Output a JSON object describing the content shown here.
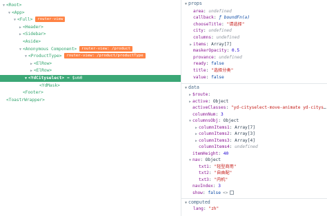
{
  "tree": [
    {
      "label": "<Root>",
      "caret": "down",
      "badge": ""
    },
    {
      "label": "<App>",
      "caret": "down",
      "badge": ""
    },
    {
      "label": "<Full>",
      "caret": "down",
      "badge": "router-view"
    },
    {
      "label": "<Header>",
      "caret": "right",
      "badge": ""
    },
    {
      "label": "<Sidebar>",
      "caret": "right",
      "badge": ""
    },
    {
      "label": "<Aside>",
      "caret": "",
      "badge": ""
    },
    {
      "label": "<Anonymous Component>",
      "caret": "down",
      "badge": "router-view: /product"
    },
    {
      "label": "<ProductType>",
      "caret": "down",
      "badge": "router-view: /product/productType"
    },
    {
      "label": "<ElRow>",
      "caret": "right",
      "badge": ""
    },
    {
      "label": "<ElRow>",
      "caret": "right",
      "badge": ""
    },
    {
      "label": "<YdCityselect>",
      "caret": "down",
      "badge": "",
      "vm": "= $vm0",
      "selected": true
    },
    {
      "label": "<YdMask>",
      "caret": "",
      "badge": ""
    },
    {
      "label": "<Footer>",
      "caret": "",
      "badge": ""
    },
    {
      "label": "<ToastrWrapper>",
      "caret": "",
      "badge": ""
    }
  ],
  "sections": {
    "props": {
      "title": "props",
      "items": [
        {
          "key": "area",
          "value": "undefined",
          "kind": "undef"
        },
        {
          "key": "callback",
          "value": "ƒ boundFn(a)",
          "kind": "fn"
        },
        {
          "key": "chooseTitle",
          "value": "\"请选择\"",
          "kind": "str"
        },
        {
          "key": "city",
          "value": "undefined",
          "kind": "undef"
        },
        {
          "key": "columns",
          "value": "undefined",
          "kind": "undef"
        },
        {
          "key": "items",
          "value": "Array[7]",
          "kind": "type",
          "caret": "right"
        },
        {
          "key": "maskerOpacity",
          "value": "0.5",
          "kind": "num"
        },
        {
          "key": "provance",
          "value": "undefined",
          "kind": "undef"
        },
        {
          "key": "ready",
          "value": "false",
          "kind": "bool"
        },
        {
          "key": "title",
          "value": "\"选择分类\"",
          "kind": "str"
        },
        {
          "key": "value",
          "value": "false",
          "kind": "bool"
        }
      ]
    },
    "data": {
      "title": "data",
      "items": [
        {
          "key": "$route",
          "value": "",
          "kind": "plain",
          "caret": "right",
          "indent": 0
        },
        {
          "key": "active",
          "value": "Object",
          "kind": "type",
          "caret": "right",
          "indent": 0
        },
        {
          "key": "activeClasses",
          "value": "\"yd-cityselect-move-animate yd-cityselect-next\"",
          "kind": "str",
          "indent": 0
        },
        {
          "key": "columnNum",
          "value": "3",
          "kind": "num",
          "indent": 0
        },
        {
          "key": "columnsObj",
          "value": "Object",
          "kind": "type",
          "caret": "down",
          "indent": 0
        },
        {
          "key": "columnItems1",
          "value": "Array[7]",
          "kind": "type",
          "caret": "right",
          "indent": 1
        },
        {
          "key": "columnItems2",
          "value": "Array[3]",
          "kind": "type",
          "caret": "right",
          "indent": 1
        },
        {
          "key": "columnItems3",
          "value": "Array[4]",
          "kind": "type",
          "caret": "right",
          "indent": 1
        },
        {
          "key": "columnItems4",
          "value": "undefined",
          "kind": "undef",
          "indent": 1
        },
        {
          "key": "itemHeight",
          "value": "40",
          "kind": "num",
          "indent": 0
        },
        {
          "key": "nav",
          "value": "Object",
          "kind": "type",
          "caret": "down",
          "indent": 0
        },
        {
          "key": "txt1",
          "value": "\"轻型商用\"",
          "kind": "str",
          "indent": 1
        },
        {
          "key": "txt2",
          "value": "\"自由配\"",
          "kind": "str",
          "indent": 1
        },
        {
          "key": "txt3",
          "value": "\"内机\"",
          "kind": "str",
          "indent": 1
        },
        {
          "key": "navIndex",
          "value": "3",
          "kind": "num",
          "indent": 0
        },
        {
          "key": "show",
          "value": "false",
          "kind": "bool",
          "indent": 0,
          "controls": true
        }
      ]
    },
    "computed": {
      "title": "computed",
      "items": [
        {
          "key": "lang",
          "value": "\"zh\"",
          "kind": "str"
        }
      ]
    }
  },
  "show_controls": {
    "reset_label": "<>"
  },
  "colors": {
    "selected_bg": "#3ba776",
    "tag": "#2fa36b",
    "badge": "#ff8344",
    "key": "#881391",
    "string": "#c41a16",
    "number": "#1c00cf"
  }
}
